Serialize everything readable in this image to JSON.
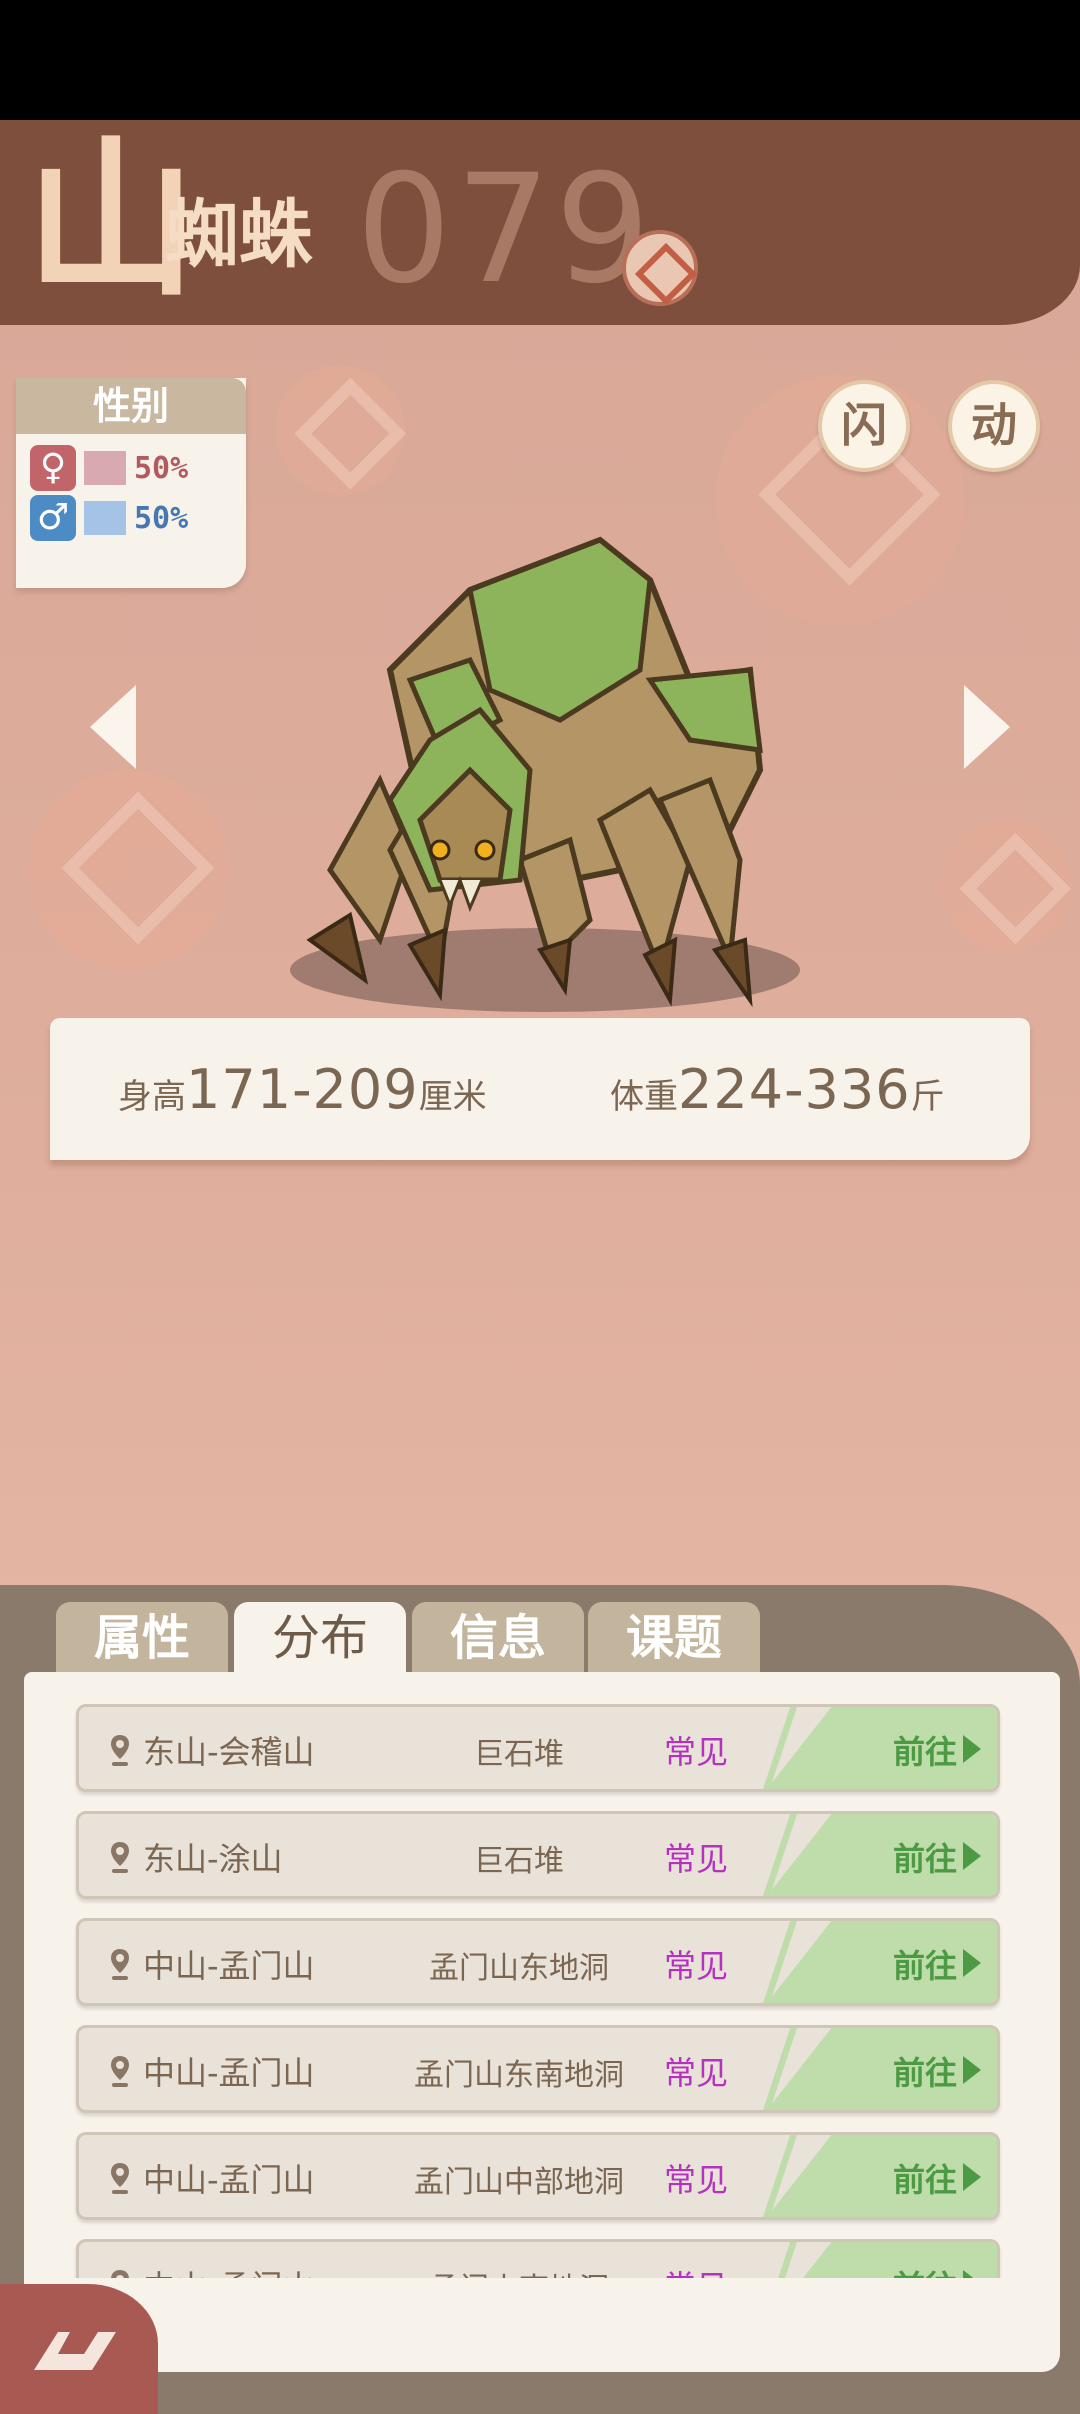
{
  "header": {
    "title_first": "山",
    "title_rest": "蜘蛛",
    "number": "079"
  },
  "gender": {
    "title": "性别",
    "female_symbol": "♀",
    "female_pct": "50%",
    "male_symbol": "♂",
    "male_pct": "50%"
  },
  "buttons": {
    "shiny": "闪",
    "animate": "动"
  },
  "size": {
    "height_label": "身高",
    "height_value": "171-209",
    "height_unit": "厘米",
    "weight_label": "体重",
    "weight_value": "224-336",
    "weight_unit": "斤"
  },
  "tabs": [
    {
      "label": "属性",
      "active": false
    },
    {
      "label": "分布",
      "active": true
    },
    {
      "label": "信息",
      "active": false
    },
    {
      "label": "课题",
      "active": false
    }
  ],
  "locations": [
    {
      "place": "东山-会稽山",
      "area": "巨石堆",
      "rarity": "常见",
      "go": "前往"
    },
    {
      "place": "东山-涂山",
      "area": "巨石堆",
      "rarity": "常见",
      "go": "前往"
    },
    {
      "place": "中山-孟门山",
      "area": "孟门山东地洞",
      "rarity": "常见",
      "go": "前往"
    },
    {
      "place": "中山-孟门山",
      "area": "孟门山东南地洞",
      "rarity": "常见",
      "go": "前往"
    },
    {
      "place": "中山-孟门山",
      "area": "孟门山中部地洞",
      "rarity": "常见",
      "go": "前往"
    },
    {
      "place": "中山-孟门山",
      "area": "孟门山南地洞",
      "rarity": "常见",
      "go": "前往"
    }
  ],
  "colors": {
    "header_bg": "#7e4f3c",
    "page_bg": "#dfae9c",
    "rarity_common": "#b532c0",
    "go_green": "#4c9a43",
    "female": "#c2656b",
    "male": "#4d8bc5"
  },
  "icons": [
    "type-badge-icon",
    "location-pin-icon",
    "arrow-left-icon",
    "arrow-right-icon",
    "play-icon",
    "logo-icon"
  ]
}
